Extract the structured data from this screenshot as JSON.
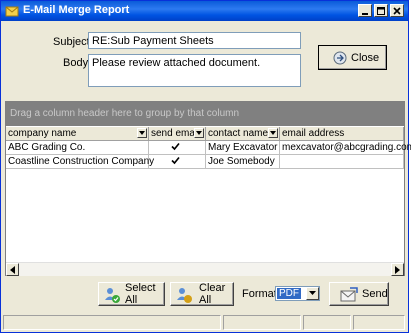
{
  "window": {
    "title": "E-Mail Merge Report"
  },
  "form": {
    "subject_label": "Subject:",
    "subject_value": "RE:Sub Payment Sheets",
    "body_label": "Body:",
    "body_value": "Please review attached document.",
    "close_label": "Close"
  },
  "grid": {
    "group_hint": "Drag a column header here to group by that column",
    "columns": [
      "company name",
      "send email",
      "contact name",
      "email address"
    ],
    "rows": [
      {
        "company": "ABC Grading Co.",
        "send_email": true,
        "contact": "Mary Excavator",
        "email": "mexcavator@abcgrading.com"
      },
      {
        "company": "Coastline Construction Company",
        "send_email": true,
        "contact": "Joe Somebody",
        "email": ""
      }
    ]
  },
  "footer": {
    "select_all_label": "Select All",
    "clear_all_label": "Clear All",
    "format_label": "Format:",
    "format_value": "PDF",
    "send_label": "Send"
  }
}
